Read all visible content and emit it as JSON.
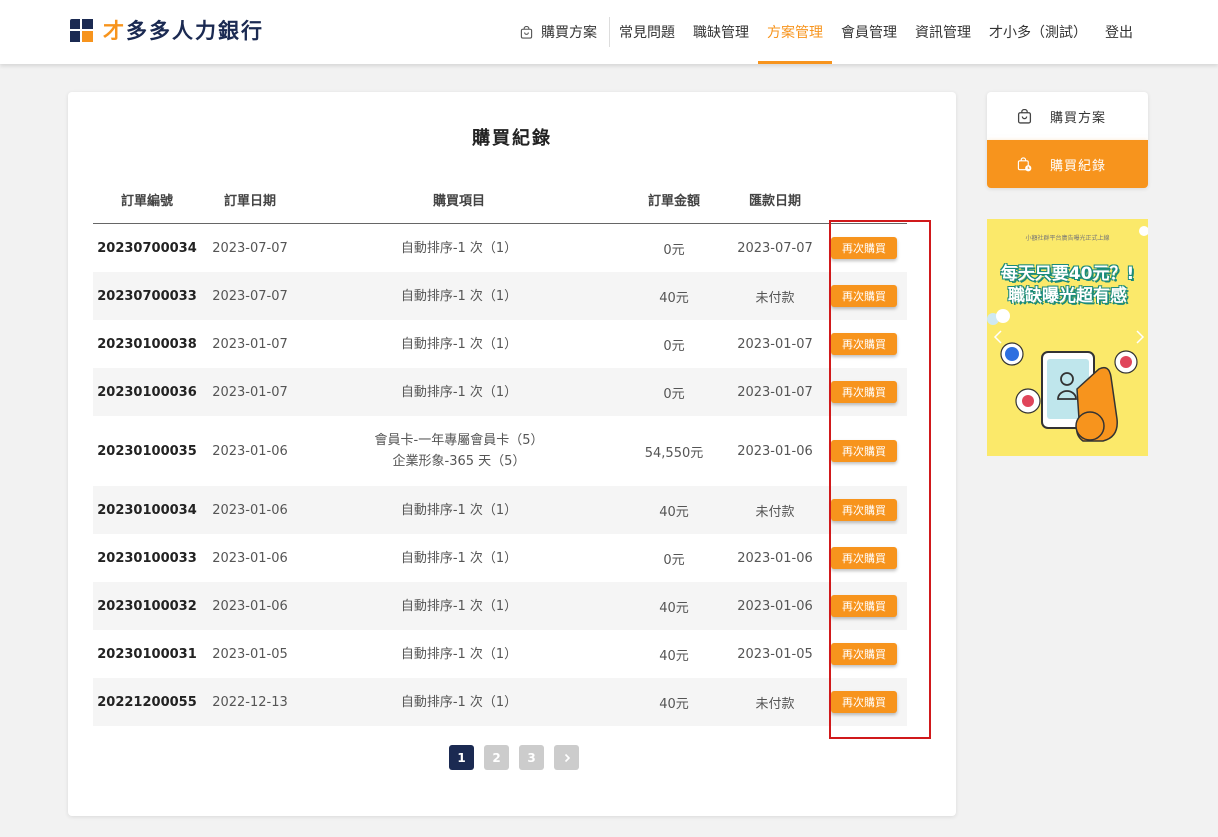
{
  "brand": {
    "name_first": "才",
    "name_rest": "多多人力銀行"
  },
  "nav": {
    "buy_plan": "購買方案",
    "items": [
      "常見問題",
      "職缺管理",
      "方案管理",
      "會員管理",
      "資訊管理",
      "才小多（測試）",
      "登出"
    ],
    "active": "方案管理"
  },
  "page": {
    "title": "購買紀錄"
  },
  "table": {
    "headers": [
      "訂單編號",
      "訂單日期",
      "購買項目",
      "訂單金額",
      "匯款日期",
      ""
    ],
    "rebuy_label": "再次購買",
    "rows": [
      {
        "id": "20230700034",
        "date": "2023-07-07",
        "items": [
          "自動排序-1 次（1）"
        ],
        "amount": "0元",
        "paid": "2023-07-07"
      },
      {
        "id": "20230700033",
        "date": "2023-07-07",
        "items": [
          "自動排序-1 次（1）"
        ],
        "amount": "40元",
        "paid": "未付款"
      },
      {
        "id": "20230100038",
        "date": "2023-01-07",
        "items": [
          "自動排序-1 次（1）"
        ],
        "amount": "0元",
        "paid": "2023-01-07"
      },
      {
        "id": "20230100036",
        "date": "2023-01-07",
        "items": [
          "自動排序-1 次（1）"
        ],
        "amount": "0元",
        "paid": "2023-01-07"
      },
      {
        "id": "20230100035",
        "date": "2023-01-06",
        "items": [
          "會員卡-一年專屬會員卡（5）",
          "企業形象-365 天（5）"
        ],
        "amount": "54,550元",
        "paid": "2023-01-06"
      },
      {
        "id": "20230100034",
        "date": "2023-01-06",
        "items": [
          "自動排序-1 次（1）"
        ],
        "amount": "40元",
        "paid": "未付款"
      },
      {
        "id": "20230100033",
        "date": "2023-01-06",
        "items": [
          "自動排序-1 次（1）"
        ],
        "amount": "0元",
        "paid": "2023-01-06"
      },
      {
        "id": "20230100032",
        "date": "2023-01-06",
        "items": [
          "自動排序-1 次（1）"
        ],
        "amount": "40元",
        "paid": "2023-01-06"
      },
      {
        "id": "20230100031",
        "date": "2023-01-05",
        "items": [
          "自動排序-1 次（1）"
        ],
        "amount": "40元",
        "paid": "2023-01-05"
      },
      {
        "id": "20221200055",
        "date": "2022-12-13",
        "items": [
          "自動排序-1 次（1）"
        ],
        "amount": "40元",
        "paid": "未付款"
      }
    ]
  },
  "pagination": {
    "pages": [
      "1",
      "2",
      "3"
    ],
    "current": "1",
    "next_icon": "chevron-right-icon"
  },
  "side_menu": {
    "items": [
      "購買方案",
      "購買紀錄"
    ],
    "active": "購買紀錄"
  },
  "banner": {
    "top": "小額社群平台廣告曝光正式上線",
    "line1": "每天只要40元？!",
    "line2": "職缺曝光超有感"
  },
  "colors": {
    "accent": "#f7941d",
    "navy": "#1b2a52",
    "highlight": "#d0191b"
  }
}
